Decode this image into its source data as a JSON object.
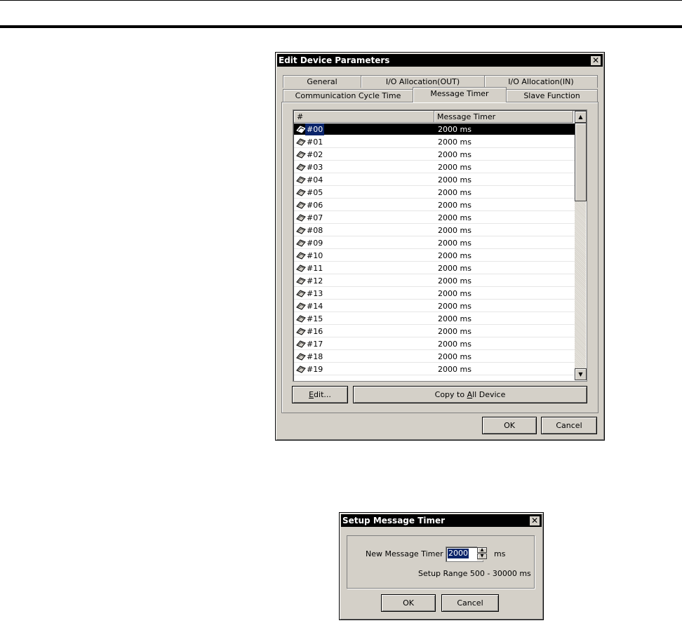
{
  "edit_dialog": {
    "title": "Edit Device Parameters",
    "close_glyph": "✕",
    "tabs_row1": [
      "General",
      "I/O Allocation(OUT)",
      "I/O Allocation(IN)"
    ],
    "tabs_row2": [
      "Communication Cycle Time",
      "Message Timer",
      "Slave Function"
    ],
    "active_tab": "Message Timer",
    "list": {
      "columns": [
        "#",
        "Message Timer"
      ],
      "rows": [
        {
          "id": "#00",
          "value": "2000 ms",
          "selected": true
        },
        {
          "id": "#01",
          "value": "2000 ms"
        },
        {
          "id": "#02",
          "value": "2000 ms"
        },
        {
          "id": "#03",
          "value": "2000 ms"
        },
        {
          "id": "#04",
          "value": "2000 ms"
        },
        {
          "id": "#05",
          "value": "2000 ms"
        },
        {
          "id": "#06",
          "value": "2000 ms"
        },
        {
          "id": "#07",
          "value": "2000 ms"
        },
        {
          "id": "#08",
          "value": "2000 ms"
        },
        {
          "id": "#09",
          "value": "2000 ms"
        },
        {
          "id": "#10",
          "value": "2000 ms"
        },
        {
          "id": "#11",
          "value": "2000 ms"
        },
        {
          "id": "#12",
          "value": "2000 ms"
        },
        {
          "id": "#13",
          "value": "2000 ms"
        },
        {
          "id": "#14",
          "value": "2000 ms"
        },
        {
          "id": "#15",
          "value": "2000 ms"
        },
        {
          "id": "#16",
          "value": "2000 ms"
        },
        {
          "id": "#17",
          "value": "2000 ms"
        },
        {
          "id": "#18",
          "value": "2000 ms"
        },
        {
          "id": "#19",
          "value": "2000 ms"
        }
      ]
    },
    "edit_button": {
      "pre": "",
      "u": "E",
      "post": "dit..."
    },
    "copy_button": {
      "pre": "Copy to ",
      "u": "A",
      "post": "ll Device"
    },
    "ok_label": "OK",
    "cancel_label": "Cancel"
  },
  "setup_dialog": {
    "title": "Setup Message Timer",
    "close_glyph": "✕",
    "field_label": "New Message Timer :",
    "field_value": "2000",
    "unit": "ms",
    "range_text": "Setup Range 500 - 30000 ms",
    "ok_label": "OK",
    "cancel_label": "Cancel"
  },
  "icons": {
    "row_icon": "device-icon",
    "scroll_up": "▲",
    "scroll_down": "▼",
    "spin_up": "▲",
    "spin_down": "▼"
  }
}
